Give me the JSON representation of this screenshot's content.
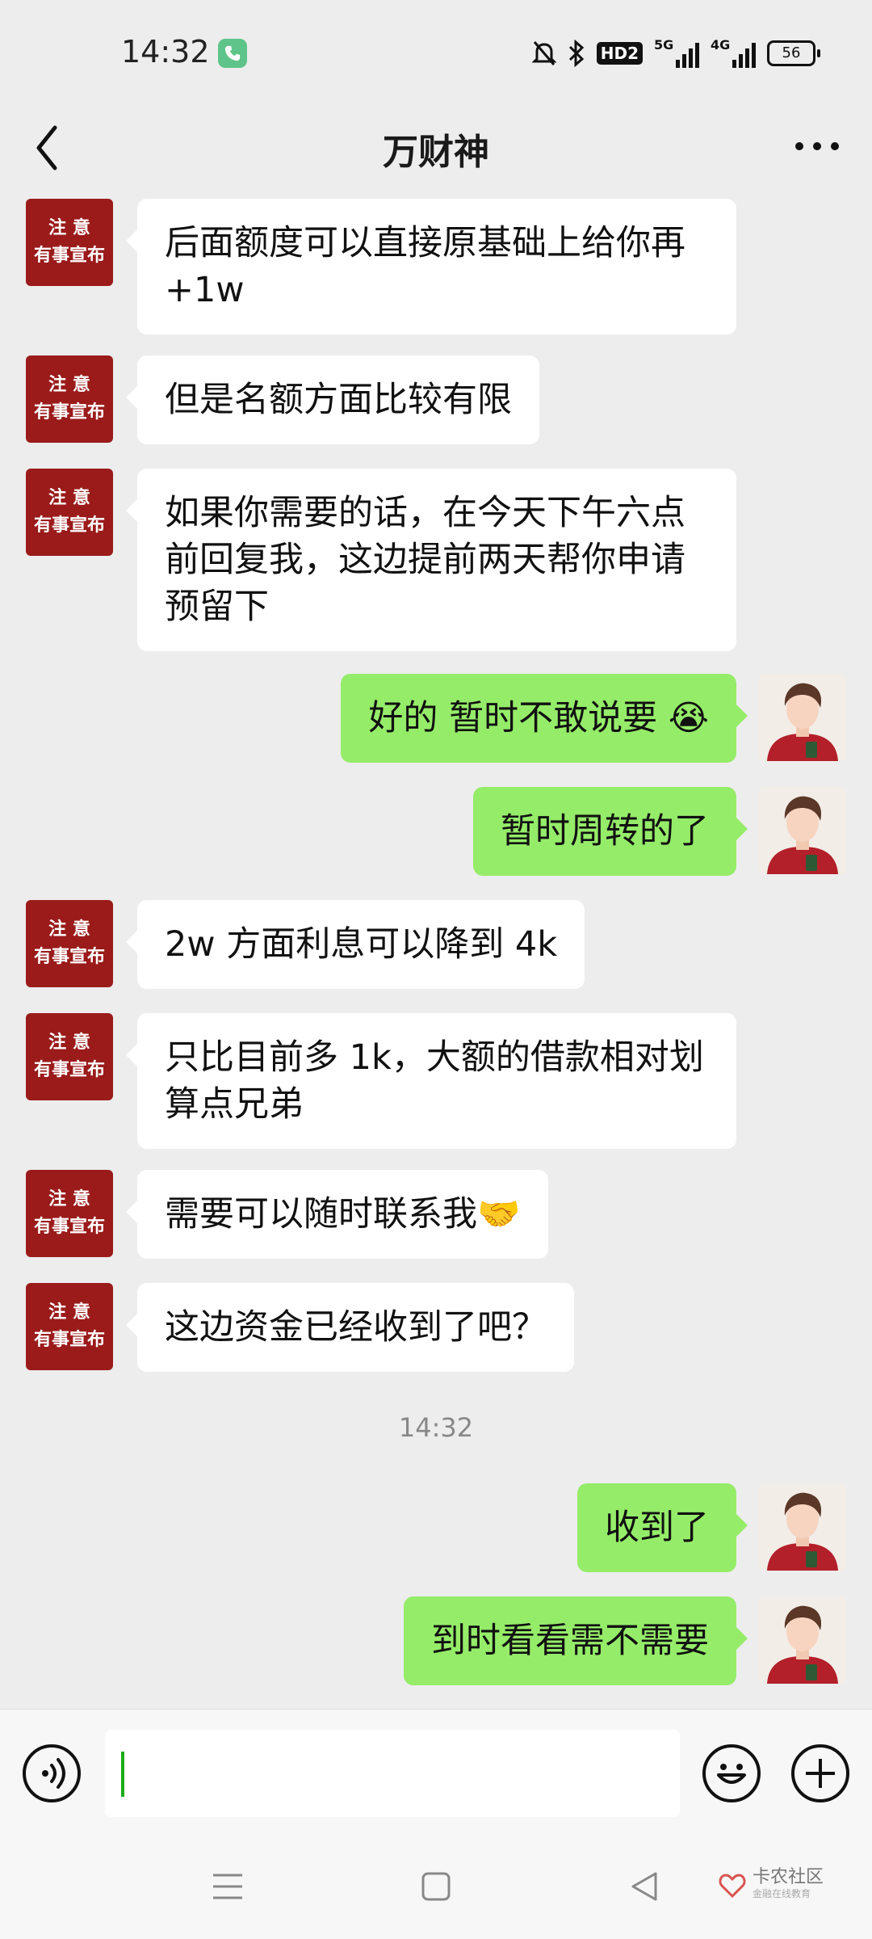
{
  "status_bar": {
    "time": "14:32",
    "hd_label": "HD2",
    "net1_label": "5G",
    "net2_label": "4G",
    "battery": "56"
  },
  "header": {
    "title": "万财神",
    "back_icon": "chevron-left-icon",
    "more_icon": "more-dots-icon"
  },
  "contact_avatar": {
    "line1": "注 意",
    "line2": "有事宣布",
    "color": "#9b1b1b"
  },
  "messages": [
    {
      "side": "left",
      "text": "后面额度可以直接原基础上给你再+1w"
    },
    {
      "side": "left",
      "text": "但是名额方面比较有限"
    },
    {
      "side": "left",
      "text": "如果你需要的话，在今天下午六点前回复我，这边提前两天帮你申请预留下"
    },
    {
      "side": "right",
      "text": "好的  暂时不敢说要 😭"
    },
    {
      "side": "right",
      "text": "暂时周转的了"
    },
    {
      "side": "left",
      "text": "2w 方面利息可以降到 4k"
    },
    {
      "side": "left",
      "text": "只比目前多 1k，大额的借款相对划算点兄弟"
    },
    {
      "side": "left",
      "text": "需要可以随时联系我🤝"
    },
    {
      "side": "left",
      "text": "这边资金已经收到了吧？"
    },
    {
      "side": "right",
      "text": "收到了"
    },
    {
      "side": "right",
      "text": "到时看看需不需要"
    }
  ],
  "timestamp": "14:32",
  "input": {
    "value": "",
    "placeholder": ""
  },
  "watermark": {
    "main": "卡农社区",
    "sub": "金融在线教育"
  },
  "colors": {
    "sent_bubble": "#95ec69",
    "received_bubble": "#ffffff",
    "background": "#ededed"
  }
}
